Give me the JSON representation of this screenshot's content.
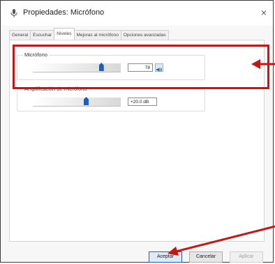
{
  "window": {
    "title": "Propiedades: Micrófono",
    "close_glyph": "×"
  },
  "tabs": [
    {
      "label": "General",
      "active": false
    },
    {
      "label": "Escuchar",
      "active": false
    },
    {
      "label": "Niveles",
      "active": true
    },
    {
      "label": "Mejoras al micrófono",
      "active": false
    },
    {
      "label": "Opciones avanzadas",
      "active": false
    }
  ],
  "levels": {
    "microphone": {
      "label": "Micrófono",
      "value": "78",
      "level": 78
    },
    "boost": {
      "label": "Amplificación de micrófono",
      "value": "+20.0 dB"
    }
  },
  "buttons": {
    "ok": "Aceptar",
    "cancel": "Cancelar",
    "apply": "Aplicar"
  },
  "colors": {
    "annotation": "#c51515",
    "slider_thumb": "#1d5fb3"
  },
  "icons": {
    "title": "microphone-icon",
    "speaker": "speaker-icon"
  }
}
